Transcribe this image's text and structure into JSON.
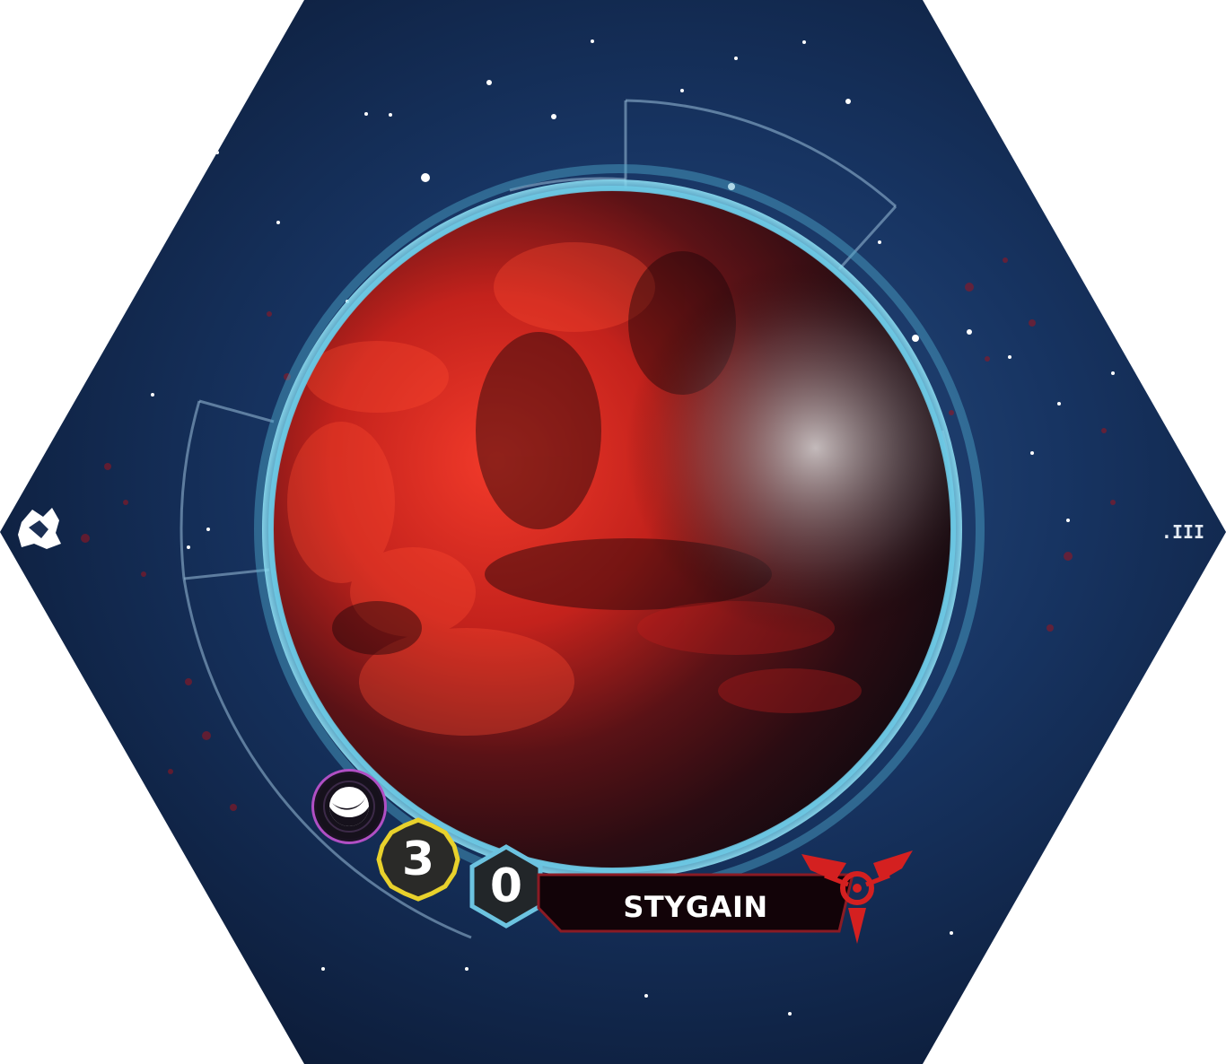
{
  "planet": {
    "name": "STYGAIN",
    "resources": "3",
    "influence": "0",
    "trait": "cultural",
    "tech_specialty": "none"
  },
  "tile": {
    "number": ".III",
    "anomaly_icon": "hazard-icon"
  },
  "faction": {
    "icon": "faction-tri-blade-icon"
  },
  "colors": {
    "space_dark": "#0b1a36",
    "space_mid": "#1d3e70",
    "planet_red": "#d8281f",
    "atmosphere": "#56b6d6",
    "resource_yellow": "#e8d12c",
    "influence_blue": "#6cc3e0",
    "trait_purple": "#b04fc4",
    "faction_red": "#d42020",
    "name_plate": "#120308"
  }
}
